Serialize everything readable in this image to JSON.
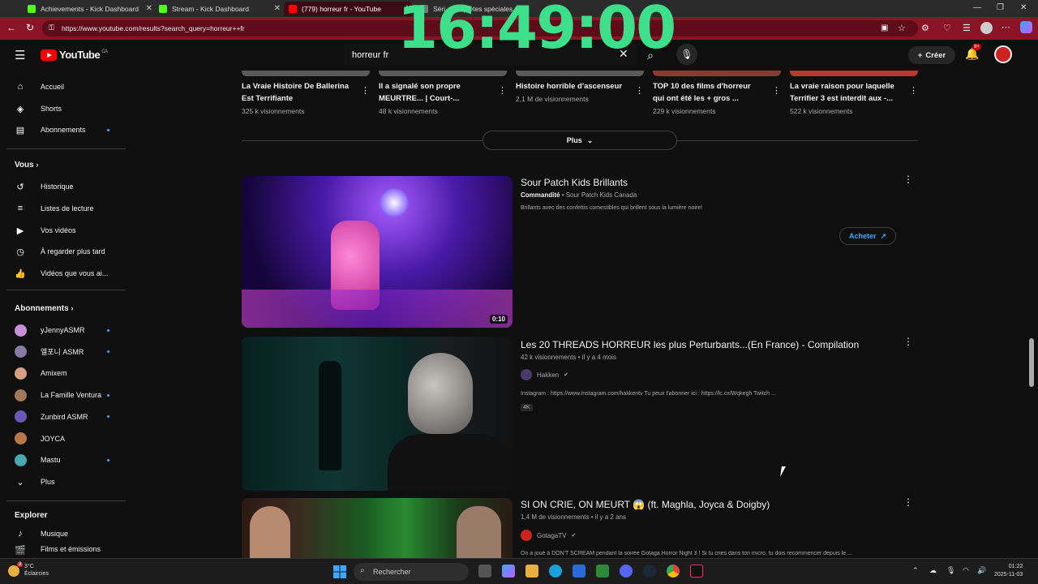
{
  "browser": {
    "tabs": [
      {
        "label": "Achievements - Kick Dashboard",
        "icon": "kick-icon"
      },
      {
        "label": "Stream - Kick Dashboard",
        "icon": "kick-icon"
      },
      {
        "label": "(779) horreur fr - YouTube",
        "icon": "youtube-icon"
      },
      {
        "label": "Séri... Enquêtes spéciales",
        "icon": "tab-icon"
      }
    ],
    "url": "https://www.youtube.com/results?search_query=horreur++fr",
    "overlay_clock": "16:49:00"
  },
  "header": {
    "logo_text": "YouTube",
    "logo_region": "CA",
    "search_value": "horreur  fr",
    "create_label": "Créer",
    "notif_count": "9+"
  },
  "sidebar": {
    "main": [
      {
        "label": "Accueil",
        "icon": "home-icon"
      },
      {
        "label": "Shorts",
        "icon": "shorts-icon"
      },
      {
        "label": "Abonnements",
        "icon": "subscriptions-icon"
      }
    ],
    "you_heading": "Vous",
    "you": [
      {
        "label": "Historique",
        "icon": "history-icon"
      },
      {
        "label": "Listes de lecture",
        "icon": "playlist-icon"
      },
      {
        "label": "Vos vidéos",
        "icon": "your-videos-icon"
      },
      {
        "label": "À regarder plus tard",
        "icon": "watch-later-icon"
      },
      {
        "label": "Vidéos que vous ai...",
        "icon": "like-icon"
      }
    ],
    "subs_heading": "Abonnements",
    "subs": [
      {
        "label": "yJennyASMR",
        "color": "#c890d8"
      },
      {
        "label": "엘포니 ASMR",
        "color": "#8a7aa8"
      },
      {
        "label": "Amixem",
        "color": "#d8a080"
      },
      {
        "label": "La Famille Ventura",
        "color": "#a07858"
      },
      {
        "label": "Zunbird ASMR",
        "color": "#6a58b8"
      },
      {
        "label": "JOYCA",
        "color": "#b87848"
      },
      {
        "label": "Mastu",
        "color": "#48a8b0"
      }
    ],
    "more_label": "Plus",
    "explore_heading": "Explorer",
    "explore": [
      {
        "label": "Musique",
        "icon": "music-icon"
      },
      {
        "label": "Films et émissions",
        "icon": "film-icon"
      }
    ]
  },
  "top_row": [
    {
      "title": "La Vraie Histoire De Ballerina Est Terrifiante",
      "views": "325 k visionnements"
    },
    {
      "title": "Il a signalé son propre MEURTRE... | Court-...",
      "views": "48 k visionnements"
    },
    {
      "title": "Histoire horrible d'ascenseur",
      "views": "2,1 M de visionnements"
    },
    {
      "title": "TOP 10 des films d'horreur qui ont été les + gros ...",
      "views": "229 k visionnements"
    },
    {
      "title": "La vraie raison pour laquelle Terrifier 3 est interdit aux -...",
      "views": "522 k visionnements"
    }
  ],
  "plus_label": "Plus",
  "results": [
    {
      "title": "Sour Patch Kids Brillants",
      "sponsored": "Commandité",
      "channel": "Sour Patch Kids Canada",
      "desc": "Brillants avec des confettis comestibles qui brillent sous la lumière noire!",
      "duration": "0:10",
      "cta": "Acheter"
    },
    {
      "title": "Les 20 THREADS HORREUR les plus Perturbants...(En France) - Compilation",
      "meta": "42 k visionnements  •  il y a 4 mois",
      "channel": "Hakken",
      "desc": "Instagram : https://www.instagram.com/hakkentv Tu peux t'abonner ici : https://lc.cx/Wqkegh Twitch ...",
      "badge": "4K"
    },
    {
      "title": "SI ON CRIE, ON MEURT 😱 (ft. Maghla, Joyca & Doigby)",
      "meta": "1,4 M de visionnements  •  il y a 2 ans",
      "channel": "GotagaTV",
      "desc": "On a joué à DON'T SCREAM pendant la soirée Gotaga Horror Night 3 ! Si tu cries dans ton micro, tu dois recommencer depuis le ..."
    }
  ],
  "taskbar": {
    "weather_temp": "3°C",
    "weather_desc": "Éclaircies",
    "search_placeholder": "Rechercher",
    "time": "01:22",
    "date": "2025-11-03",
    "weather_badge": "3"
  }
}
